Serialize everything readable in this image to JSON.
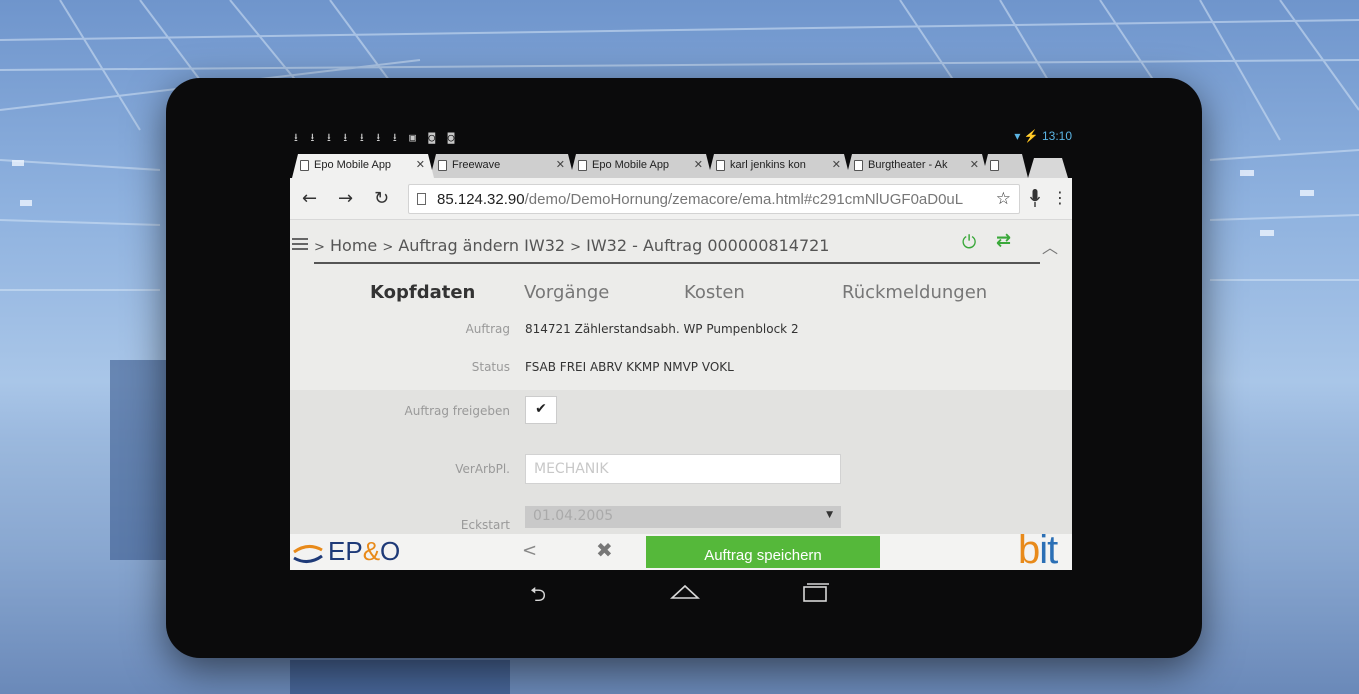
{
  "status_bar": {
    "notification_icons": "⭳ ⭳ ⭳ ⭳ ⭳ ⭳ ⭳ ▣ ◙ ◙",
    "time": "13:10"
  },
  "browser": {
    "tabs": [
      {
        "label": "Epo Mobile App"
      },
      {
        "label": "Freewave"
      },
      {
        "label": "Epo Mobile App"
      },
      {
        "label": "karl jenkins kon"
      },
      {
        "label": "Burgtheater - Ak"
      }
    ],
    "url_host": "85.124.32.90",
    "url_path": "/demo/DemoHornung/zemacore/ema.html#c291cmNlUGF0aD0uL"
  },
  "app": {
    "breadcrumb": {
      "sep": ">",
      "home": "Home",
      "level2": "Auftrag ändern IW32",
      "level3": "IW32 - Auftrag 000000814721"
    },
    "tabs": [
      "Kopfdaten",
      "Vorgänge",
      "Kosten",
      "Rückmeldungen"
    ],
    "fields": {
      "auftrag_label": "Auftrag",
      "auftrag_value": "814721 Zählerstandsabh. WP Pumpenblock 2",
      "status_label": "Status",
      "status_value": "FSAB FREI ABRV KKMP NMVP VOKL",
      "freigeben_label": "Auftrag freigeben",
      "freigeben_checked": "✔",
      "verarbpl_label": "VerArbPl.",
      "verarbpl_value": "MECHANIK",
      "eckstart_label": "Eckstart",
      "eckstart_value": "01.04.2005"
    },
    "bottom": {
      "logo_left_ep": "EP",
      "logo_left_amp": "&",
      "logo_left_o": "O",
      "back": "<",
      "cancel": "✖",
      "save_label": "Auftrag speichern",
      "logo_right_b": "b",
      "logo_right_it": "it"
    }
  },
  "colors": {
    "accent_green": "#55b83a",
    "brand_orange": "#e88a1a",
    "brand_blue": "#1e3a78"
  }
}
